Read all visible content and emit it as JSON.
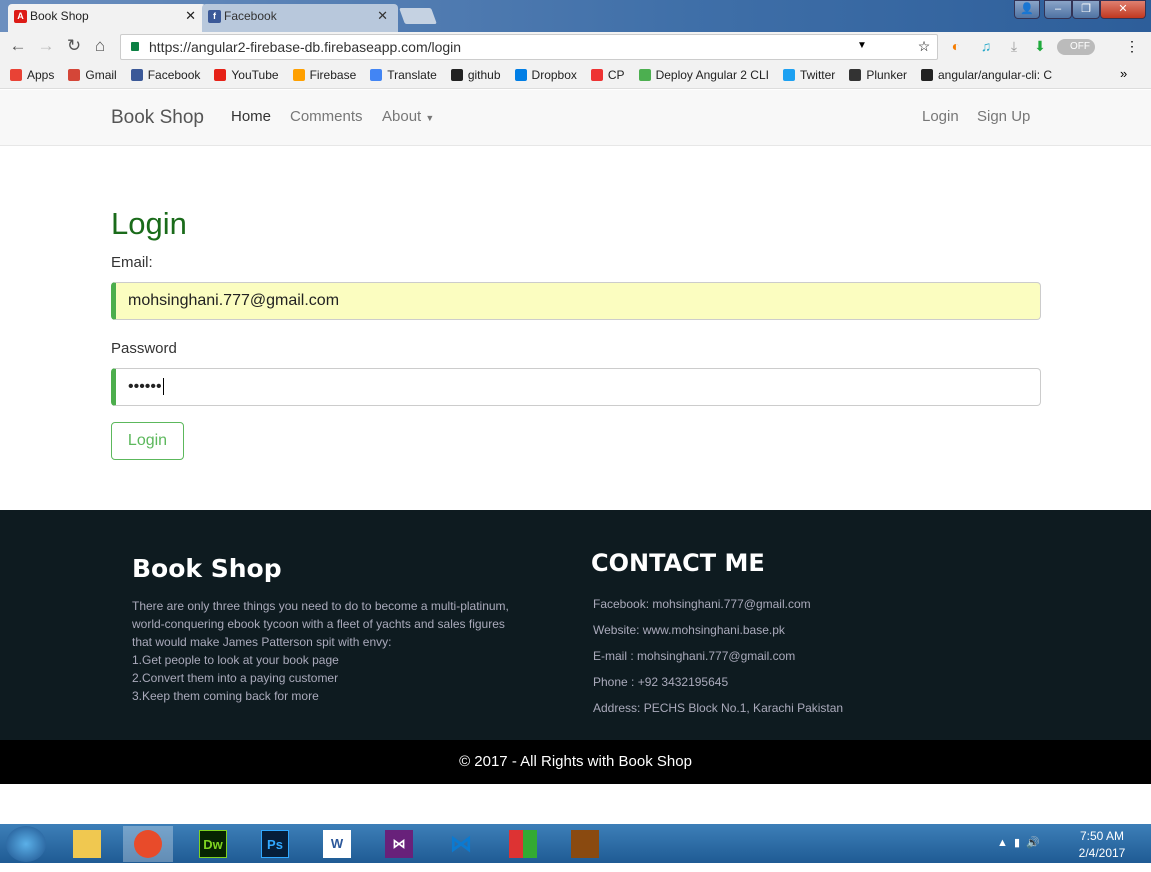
{
  "browser": {
    "tabs": [
      {
        "label": "Book Shop",
        "icon": "angular-icon"
      },
      {
        "label": "Facebook",
        "icon": "facebook-icon"
      }
    ],
    "url": "https://angular2-firebase-db.firebaseapp.com/login",
    "extension_toggle": "OFF",
    "bookmarks": [
      {
        "label": "Apps",
        "color": "#e94235"
      },
      {
        "label": "Gmail",
        "color": "#d44638"
      },
      {
        "label": "Facebook",
        "color": "#3b5998"
      },
      {
        "label": "YouTube",
        "color": "#e62117"
      },
      {
        "label": "Firebase",
        "color": "#ffa000"
      },
      {
        "label": "Translate",
        "color": "#4285f4"
      },
      {
        "label": "github",
        "color": "#222"
      },
      {
        "label": "Dropbox",
        "color": "#007ee5"
      },
      {
        "label": "CP",
        "color": "#e33"
      },
      {
        "label": "Deploy Angular 2 CLI",
        "color": "#4caf50"
      },
      {
        "label": "Twitter",
        "color": "#1da1f2"
      },
      {
        "label": "Plunker",
        "color": "#333"
      },
      {
        "label": "angular/angular-cli: C",
        "color": "#222"
      }
    ],
    "more": "»"
  },
  "navbar": {
    "brand": "Book Shop",
    "links": [
      "Home",
      "Comments",
      "About"
    ],
    "right": [
      "Login",
      "Sign Up"
    ]
  },
  "login": {
    "title": "Login",
    "email_label": "Email:",
    "email_value": "mohsinghani.777@gmail.com",
    "password_label": "Password",
    "password_value": "••••••",
    "button": "Login"
  },
  "footer": {
    "title": "Book Shop",
    "lines": [
      "There are only three things you need to do to become a multi-platinum,",
      "world-conquering ebook tycoon with a fleet of yachts and sales figures",
      "that would make James Patterson spit with envy:",
      "1.Get people to look at your book page",
      "2.Convert them into a paying customer",
      "3.Keep them coming back for more"
    ],
    "contact_title": "CONTACT ME",
    "contact": [
      "Facebook: mohsinghani.777@gmail.com",
      "Website: www.mohsinghani.base.pk",
      "E-mail : mohsinghani.777@gmail.com",
      "Phone : +92 3432195645",
      "Address: PECHS Block No.1, Karachi Pakistan"
    ],
    "copyright": "© 2017 - All Rights with Book Shop"
  },
  "taskbar": {
    "apps": [
      "Dw",
      "Ps",
      "W"
    ],
    "time": "7:50 AM",
    "date": "2/4/2017"
  },
  "colors": {
    "accent": "#5cb85c",
    "heading": "#1a6b1a",
    "footer_bg": "#0e1b20"
  }
}
